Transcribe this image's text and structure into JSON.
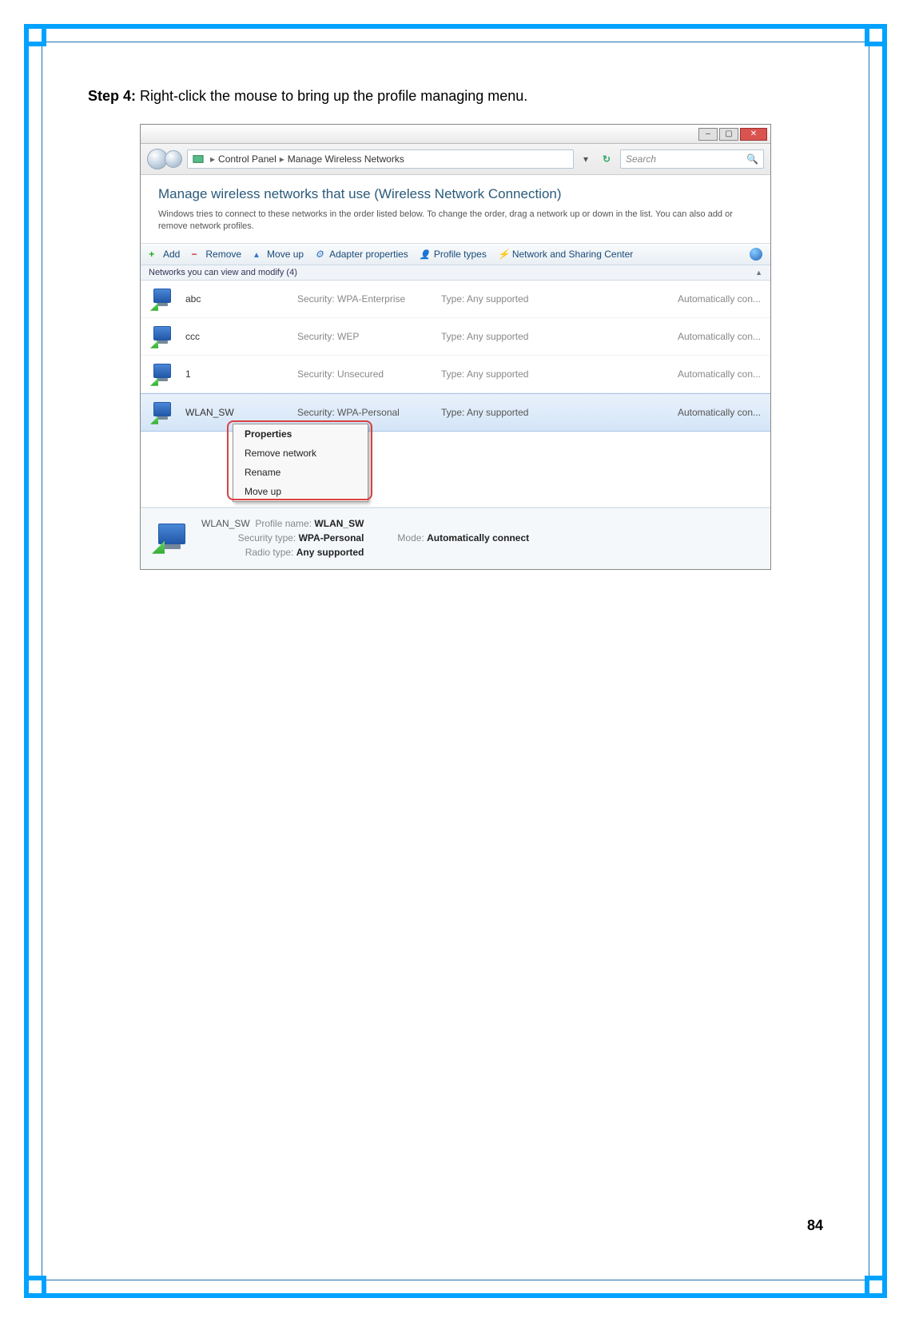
{
  "page": {
    "step_label": "Step 4:",
    "step_text": "Right-click the mouse to bring up the profile managing menu.",
    "page_number": "84"
  },
  "window": {
    "breadcrumb_root": "Control Panel",
    "breadcrumb_item": "Manage Wireless Networks",
    "search_placeholder": "Search",
    "heading": "Manage wireless networks that use (Wireless Network Connection)",
    "subtext": "Windows tries to connect to these networks in the order listed below. To change the order, drag a network up or down in the list. You can also add or remove network profiles.",
    "group_header": "Networks you can view and modify (4)"
  },
  "toolbar": {
    "add": "Add",
    "remove": "Remove",
    "moveup": "Move up",
    "adapter": "Adapter properties",
    "profiletypes": "Profile types",
    "nsc": "Network and Sharing Center"
  },
  "columns": {
    "security_prefix": "Security:",
    "type_prefix": "Type:",
    "mode_value": "Automatically con..."
  },
  "networks": [
    {
      "name": "abc",
      "security": "WPA-Enterprise",
      "type": "Any supported"
    },
    {
      "name": "ccc",
      "security": "WEP",
      "type": "Any supported"
    },
    {
      "name": "1",
      "security": "Unsecured",
      "type": "Any supported"
    },
    {
      "name": "WLAN_SW",
      "security": "WPA-Personal",
      "type": "Any supported"
    }
  ],
  "context_menu": {
    "properties": "Properties",
    "remove": "Remove network",
    "rename": "Rename",
    "moveup": "Move up"
  },
  "details": {
    "name_value": "WLAN_SW",
    "profile_label": "Profile name:",
    "profile_value": "WLAN_SW",
    "security_label": "Security type:",
    "security_value": "WPA-Personal",
    "radio_label": "Radio type:",
    "radio_value": "Any supported",
    "mode_label": "Mode:",
    "mode_value": "Automatically connect"
  }
}
